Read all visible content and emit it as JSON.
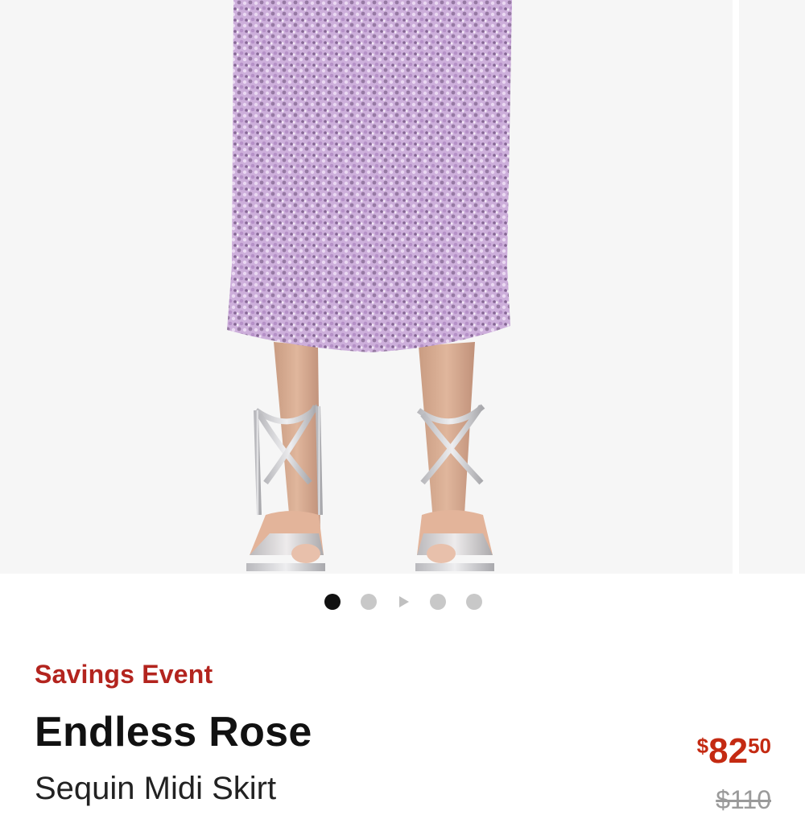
{
  "product": {
    "image_alt": "Sequin midi skirt worn with silver strappy heels",
    "event_label": "Savings Event",
    "brand": "Endless Rose",
    "name": "Sequin Midi Skirt",
    "price": {
      "currency_symbol": "$",
      "whole": "82",
      "cents": "50"
    },
    "original_price": "$110"
  },
  "carousel": {
    "total_slides": 5,
    "active_index": 0,
    "has_video": true
  },
  "colors": {
    "event_red": "#b3241e",
    "price_red": "#c42a12",
    "skirt_lilac": "#c8a6d6",
    "dot_active": "#111111",
    "dot_inactive": "#c8c8c8"
  }
}
